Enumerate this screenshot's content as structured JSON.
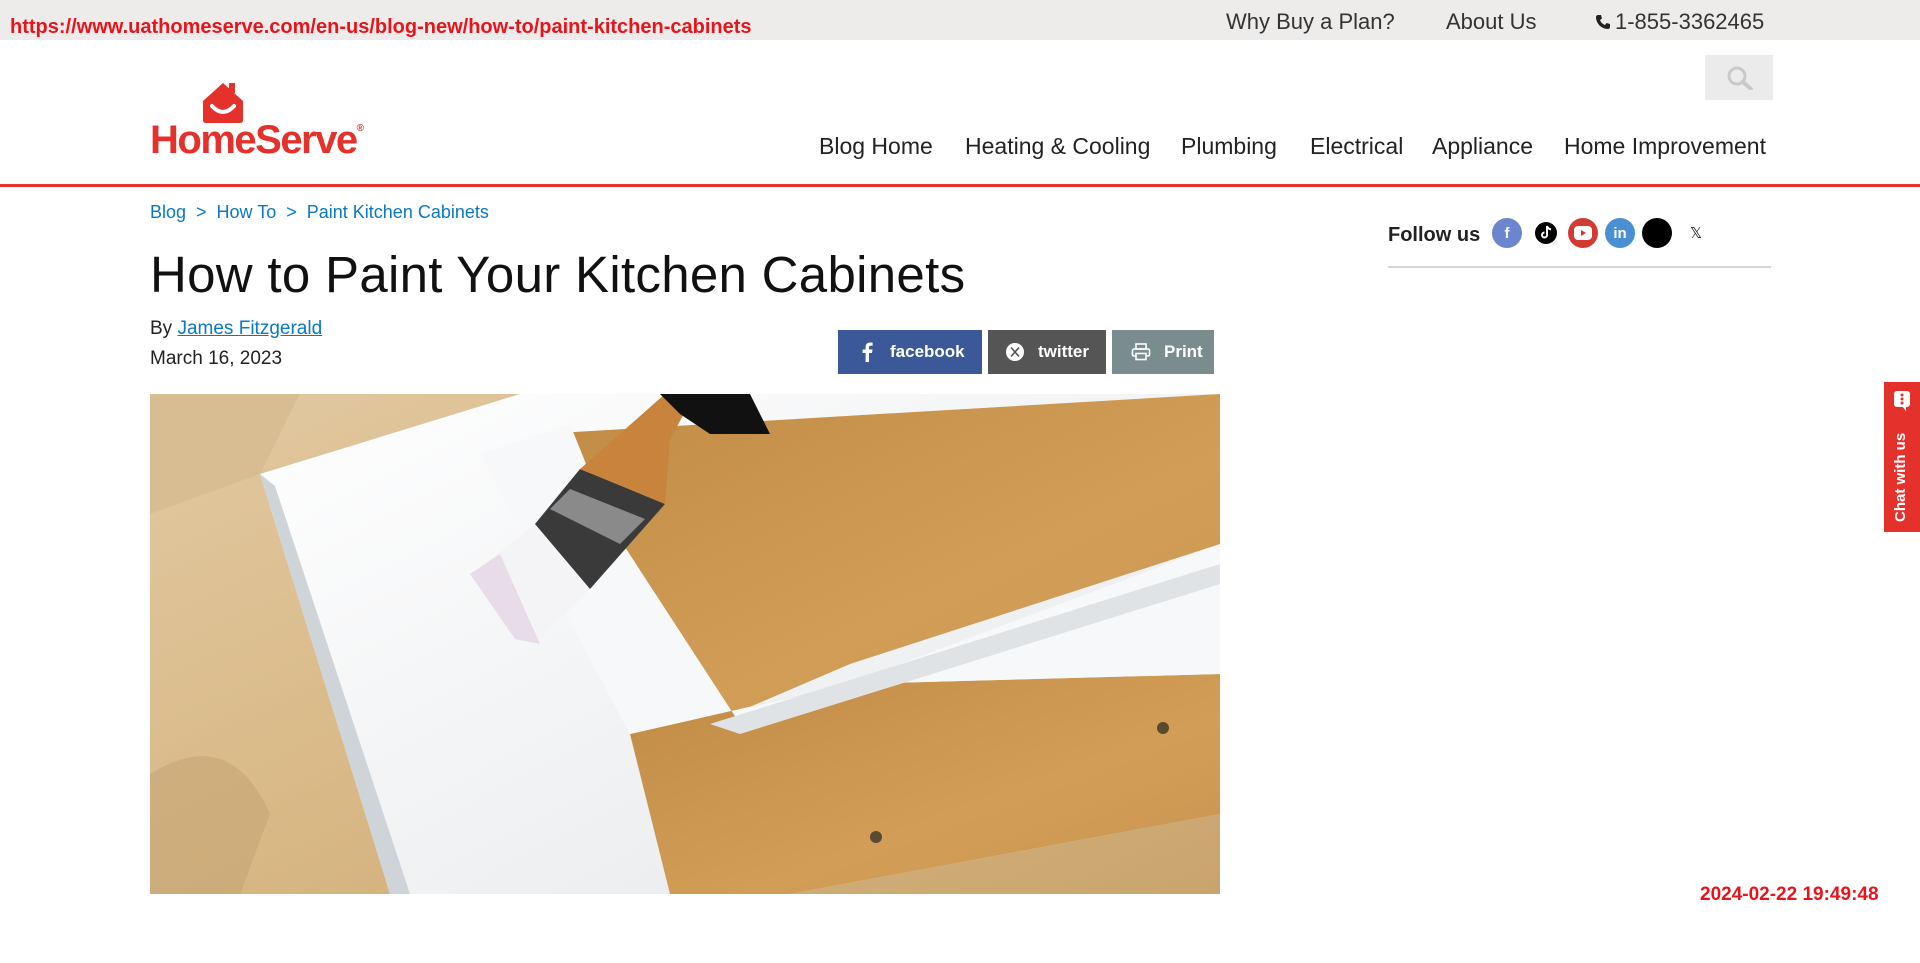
{
  "overlay": {
    "url": "https://www.uathomeserve.com/en-us/blog-new/how-to/paint-kitchen-cabinets",
    "timestamp": "2024-02-22 19:49:48"
  },
  "utility_nav": {
    "why_buy": "Why Buy a Plan?",
    "about": "About Us",
    "phone": "1-855-3362465"
  },
  "logo": {
    "text": "HomeServe",
    "mark": "®"
  },
  "main_nav": {
    "items": [
      "Blog Home",
      "Heating & Cooling",
      "Plumbing",
      "Electrical",
      "Appliance",
      "Home Improvement"
    ]
  },
  "breadcrumb": {
    "items": [
      "Blog",
      "How To",
      "Paint Kitchen Cabinets"
    ],
    "separator": ">"
  },
  "article": {
    "title": "How to Paint Your Kitchen Cabinets",
    "by_prefix": "By",
    "author": "James Fitzgerald",
    "date": "March 16, 2023",
    "hero_icon": "painted-cabinet-door-image"
  },
  "share": {
    "facebook": "facebook",
    "twitter": "twitter",
    "print": "Print"
  },
  "sidebar": {
    "follow_label": "Follow us",
    "x_glyph": "𝕏"
  },
  "chat": {
    "label": "Chat with us"
  },
  "colors": {
    "brand_red": "#e4312b",
    "link_blue": "#0a78c2",
    "facebook_blue": "#3b5998",
    "twitter_gray": "#555555",
    "print_gray": "#7a8c8e"
  }
}
